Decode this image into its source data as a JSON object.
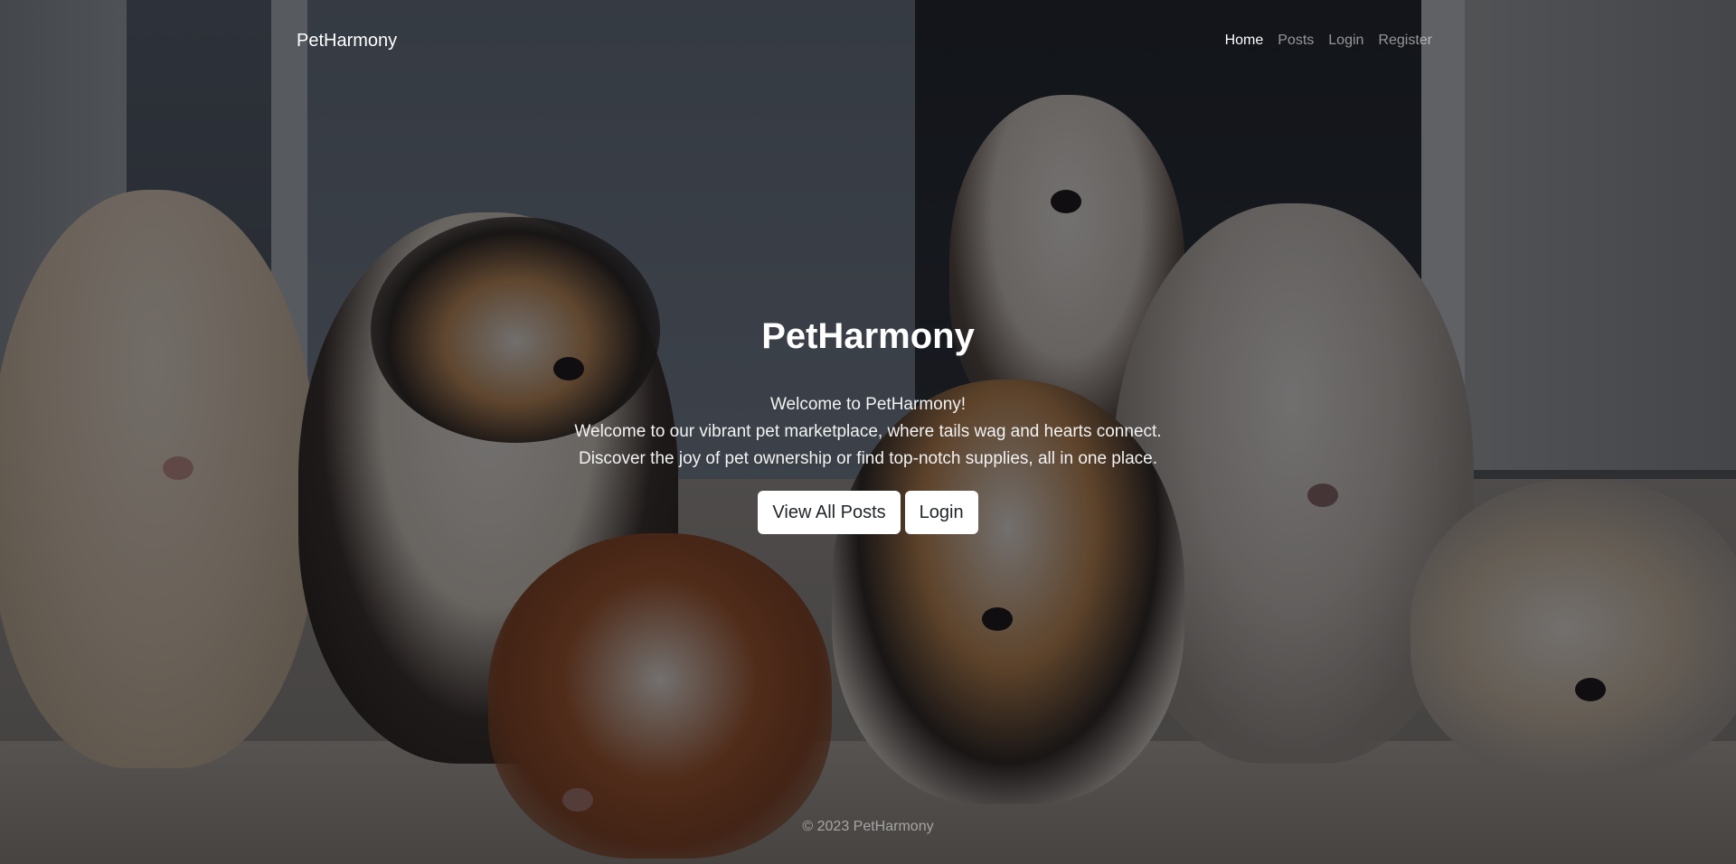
{
  "navbar": {
    "brand": "PetHarmony",
    "links": [
      {
        "label": "Home",
        "active": true
      },
      {
        "label": "Posts",
        "active": false
      },
      {
        "label": "Login",
        "active": false
      },
      {
        "label": "Register",
        "active": false
      }
    ]
  },
  "hero": {
    "background": "puppies-photo",
    "title": "PetHarmony",
    "lines": [
      "Welcome to PetHarmony!",
      "Welcome to our vibrant pet marketplace, where tails wag and hearts connect.",
      "Discover the joy of pet ownership or find top-notch supplies, all in one place."
    ],
    "buttons": {
      "view_all_posts": "View All Posts",
      "login": "Login"
    }
  },
  "footer": {
    "copyright": "© 2023 PetHarmony"
  }
}
